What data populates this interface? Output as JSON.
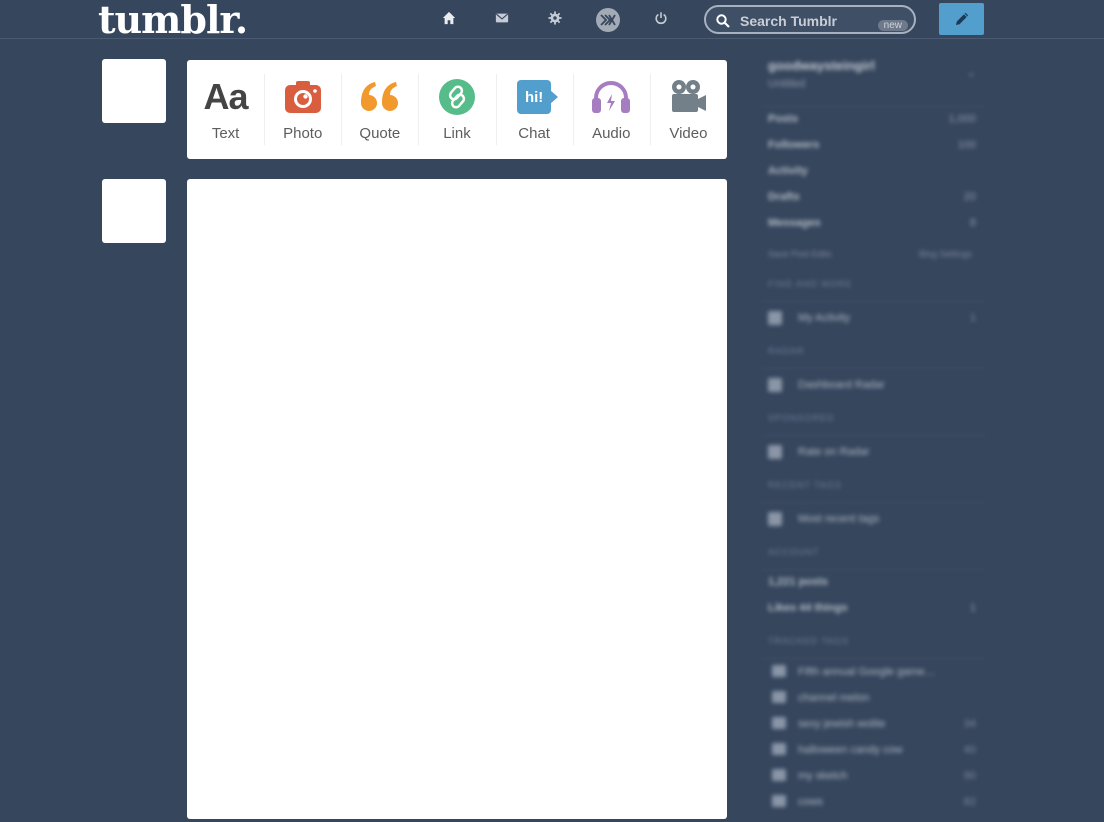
{
  "header": {
    "logo": "tumblr.",
    "search": {
      "placeholder": "Search Tumblr",
      "badge": "new"
    }
  },
  "icons": {
    "home": "home-icon",
    "inbox": "envelope-icon",
    "settings": "gear-icon",
    "xkit": "xkit-icon",
    "logout": "power-icon",
    "compose": "pencil-icon"
  },
  "post_types": [
    {
      "label": "Text",
      "icon": "Aa",
      "color": "#444444"
    },
    {
      "label": "Photo",
      "icon": "camera-icon",
      "color": "#d95e40"
    },
    {
      "label": "Quote",
      "icon": "quote-icon",
      "color": "#f2992e"
    },
    {
      "label": "Link",
      "icon": "link-icon",
      "color": "#56bc8a"
    },
    {
      "label": "Chat",
      "icon": "hi!",
      "color": "#529ecc"
    },
    {
      "label": "Audio",
      "icon": "headphones-icon",
      "color": "#a77dc2"
    },
    {
      "label": "Video",
      "icon": "video-camera-icon",
      "color": "#748089"
    }
  ],
  "sidebar": {
    "blog_name": "goodwaysteingirl",
    "blog_sub": "Untitled",
    "stats": [
      {
        "label": "Posts",
        "count": "1,000"
      },
      {
        "label": "Followers",
        "count": "100"
      },
      {
        "label": "Activity",
        "count": ""
      },
      {
        "label": "Drafts",
        "count": "20"
      },
      {
        "label": "Messages",
        "count": "8"
      }
    ],
    "links": {
      "left": "Save Post Edits",
      "right": "Blog Settings"
    },
    "sections": [
      {
        "heading": "FIND AND MORE",
        "items": [
          {
            "label": "My Activity",
            "count": "1"
          }
        ]
      },
      {
        "heading": "RADAR",
        "items": [
          {
            "label": "Dashboard Radar",
            "count": ""
          }
        ]
      },
      {
        "heading": "SPONSORED",
        "items": [
          {
            "label": "Rate on Radar",
            "count": ""
          }
        ]
      },
      {
        "heading": "RECENT TAGS",
        "items": [
          {
            "label": "Most recent tags",
            "count": ""
          }
        ]
      },
      {
        "heading": "ACCOUNT",
        "items": [
          {
            "label": "1,221 posts",
            "count": ""
          },
          {
            "label": "Likes 44 things",
            "count": "1"
          }
        ]
      }
    ],
    "tags_heading": "TRACKED TAGS",
    "tags": [
      {
        "label": "Fifth annual Google game…",
        "count": ""
      },
      {
        "label": "channel melon",
        "count": ""
      },
      {
        "label": "sexy jewish wolite",
        "count": "34"
      },
      {
        "label": "halloween candy cow",
        "count": "40"
      },
      {
        "label": "my sketch",
        "count": "90"
      },
      {
        "label": "cows",
        "count": "82"
      }
    ]
  }
}
